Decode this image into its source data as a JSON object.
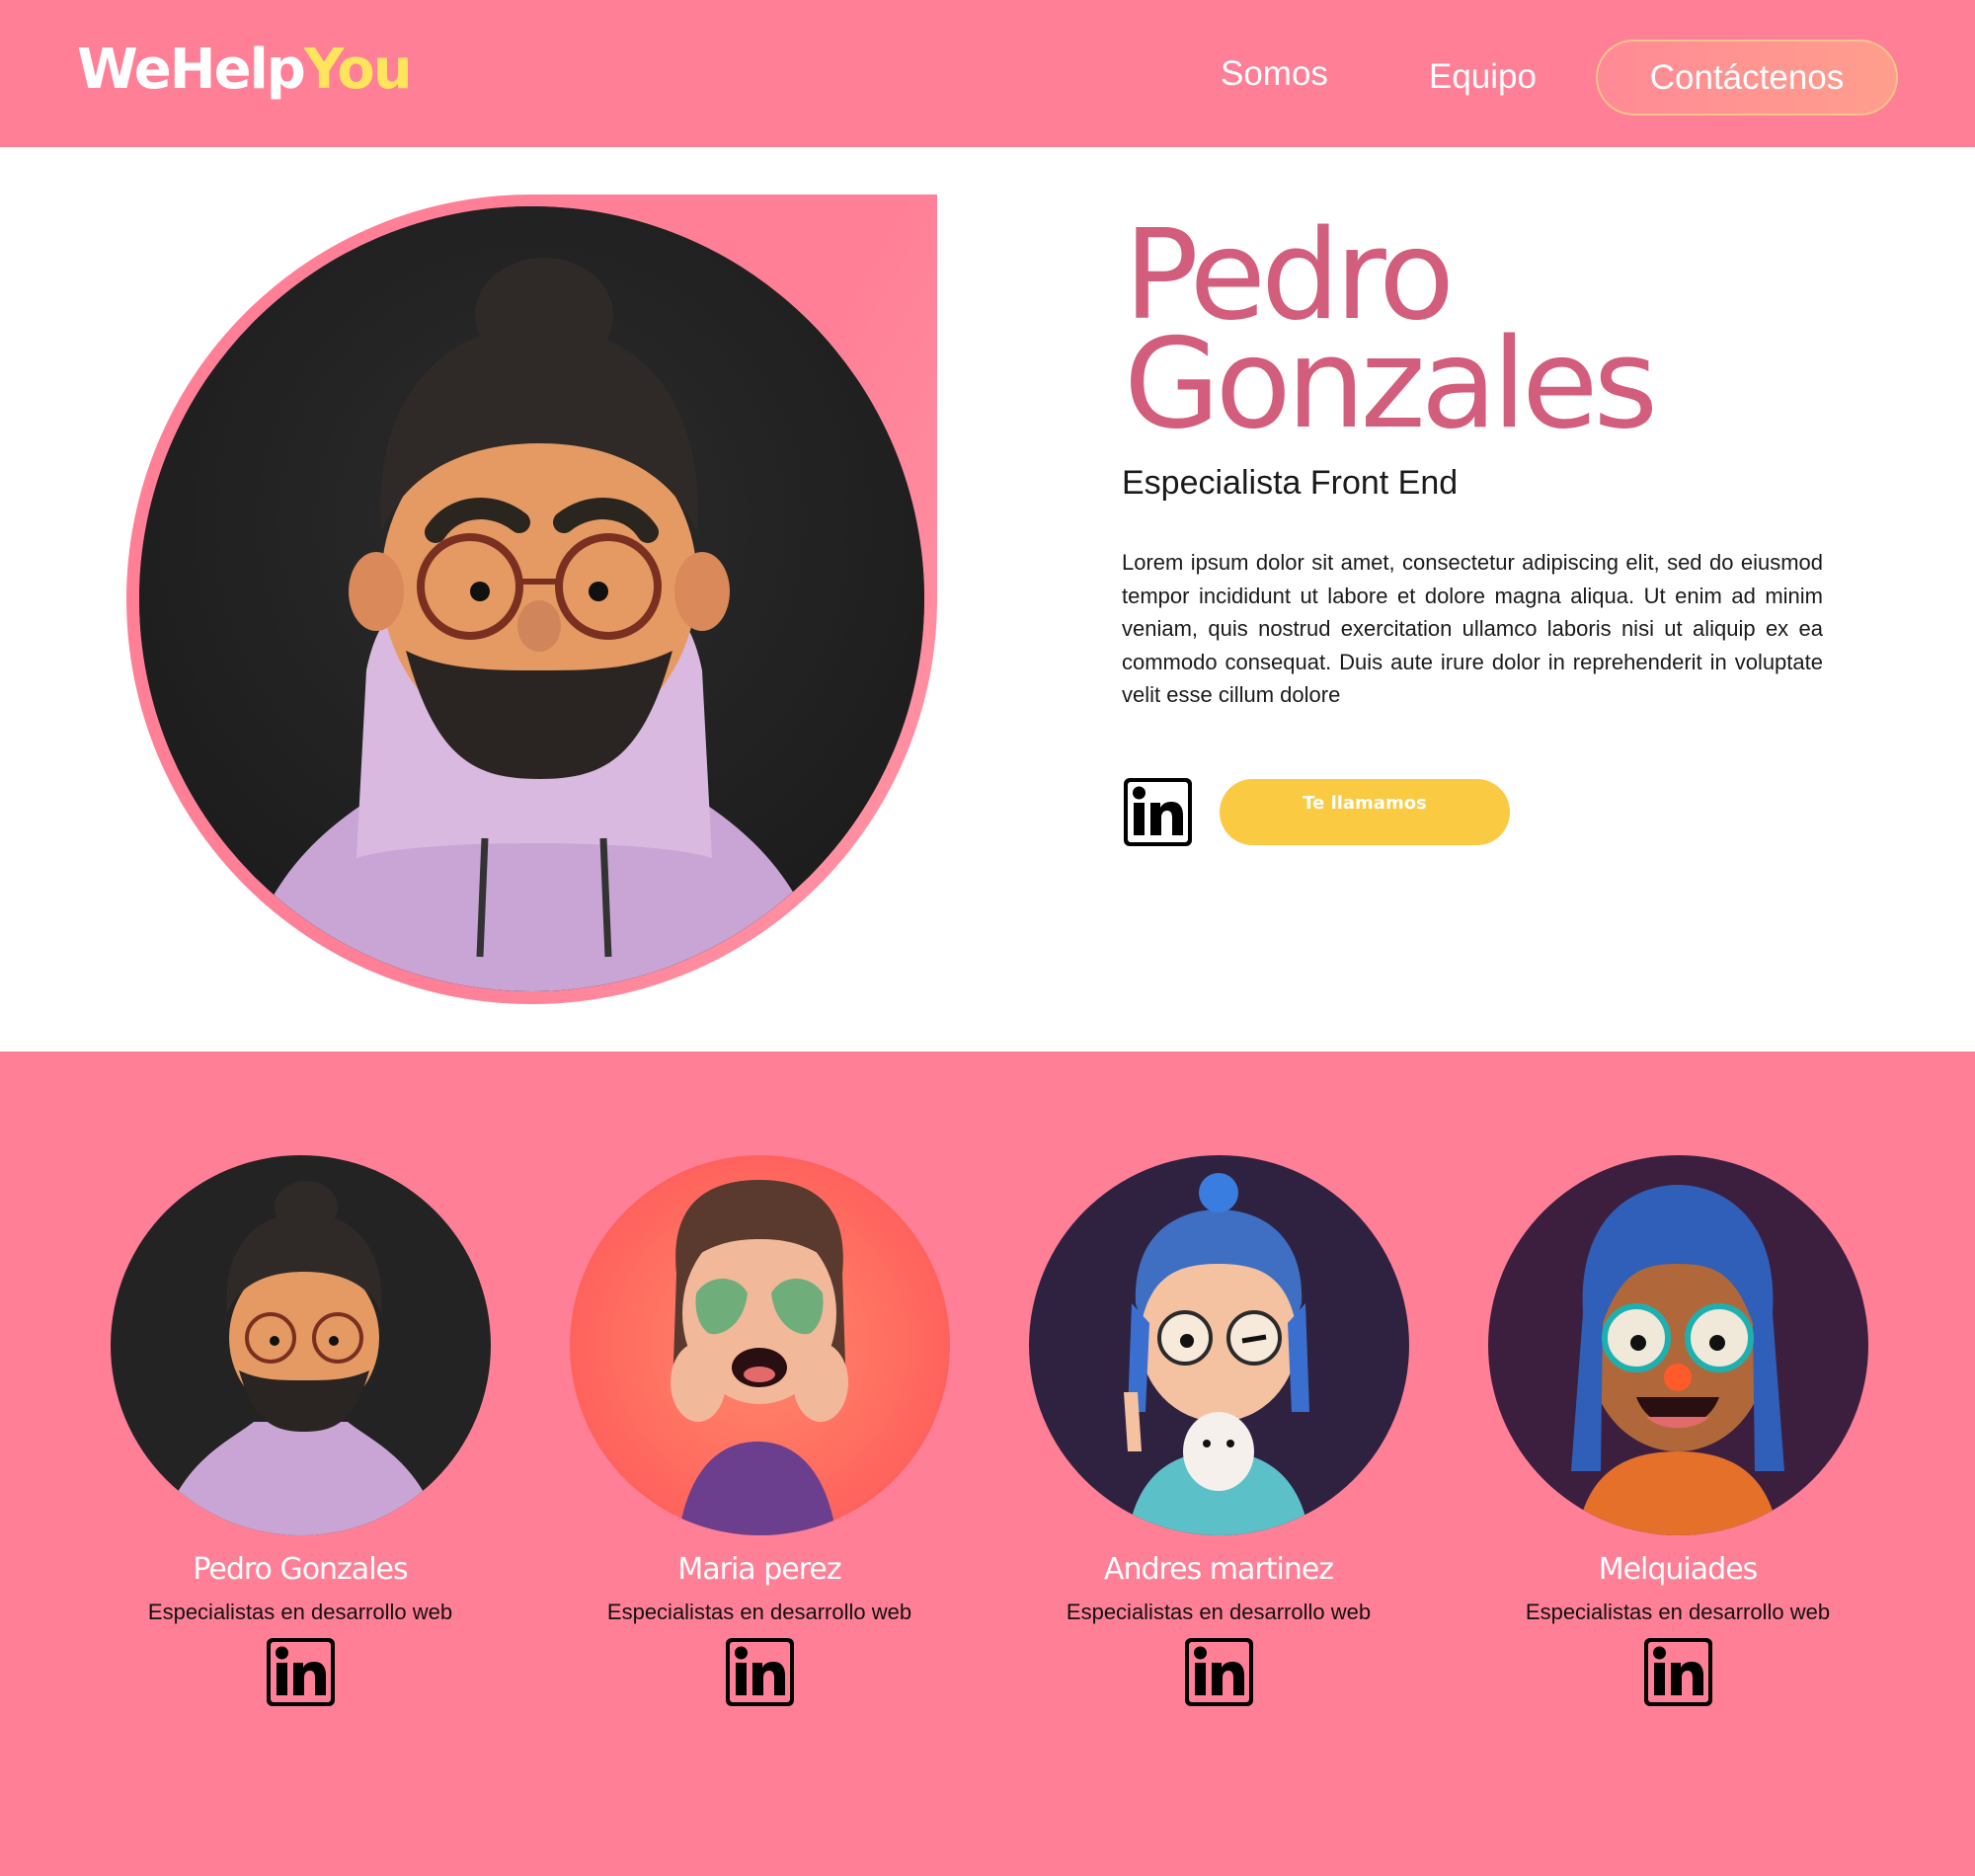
{
  "brand": {
    "part1": "WeHelp",
    "part2": "You"
  },
  "nav": {
    "somos": "Somos",
    "equipo": "Equipo",
    "contact": "Contáctenos"
  },
  "hero": {
    "name_line1": "Pedro",
    "name_line2": "Gonzales",
    "role": "Especialista Front End",
    "description": "Lorem ipsum dolor sit amet, consectetur adipiscing elit, sed do eiusmod tempor incididunt ut labore et dolore magna aliqua. Ut enim ad minim veniam, quis nostrud exercitation ullamco laboris nisi ut aliquip ex ea commodo consequat. Duis aute irure dolor in reprehenderit in voluptate velit esse cillum dolore",
    "call_button": "Te llamamos",
    "linkedin_icon": "linkedin-icon"
  },
  "team": [
    {
      "name": "Pedro Gonzales",
      "role": "Especialistas en desarrollo web",
      "avatar": "bearded-man-avatar"
    },
    {
      "name": "Maria perez",
      "role": "Especialistas en desarrollo web",
      "avatar": "smiling-woman-avatar"
    },
    {
      "name": "Andres martinez",
      "role": "Especialistas en desarrollo web",
      "avatar": "helmet-kid-avatar"
    },
    {
      "name": "Melquiades",
      "role": "Especialistas en desarrollo web",
      "avatar": "blue-hair-avatar"
    }
  ],
  "colors": {
    "header_bg": "#ff7f96",
    "accent_pink": "#d25d7d",
    "brand_yellow": "#ffe45c",
    "button_yellow": "#fbca43",
    "team_bg": "#ff7f96"
  }
}
